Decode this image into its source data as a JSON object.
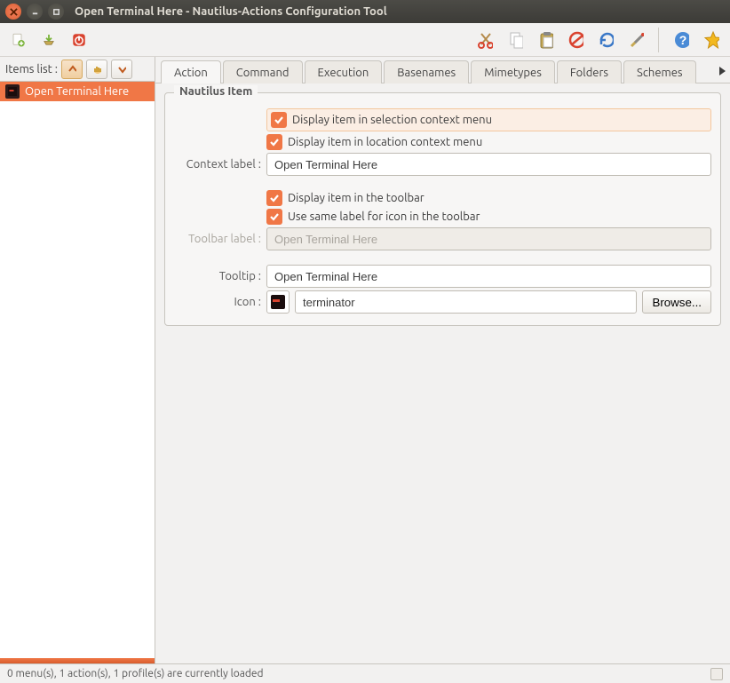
{
  "window": {
    "title": "Open Terminal Here - Nautilus-Actions Configuration Tool"
  },
  "listHeader": {
    "label": "Items list :"
  },
  "tree": {
    "items": [
      {
        "label": "Open Terminal Here"
      }
    ]
  },
  "tabs": {
    "items": [
      "Action",
      "Command",
      "Execution",
      "Basenames",
      "Mimetypes",
      "Folders",
      "Schemes"
    ],
    "active": 0
  },
  "group": {
    "title": "Nautilus Item"
  },
  "form": {
    "cbSelection": "Display item in selection context menu",
    "cbLocation": "Display item in location context menu",
    "contextLabel": "Context label :",
    "contextValue": "Open Terminal Here",
    "cbToolbar": "Display item in the toolbar",
    "cbSameLabel": "Use same label for icon in the toolbar",
    "toolbarLabel": "Toolbar label :",
    "toolbarValue": "Open Terminal Here",
    "tooltipLabel": "Tooltip :",
    "tooltipValue": "Open Terminal Here",
    "iconLabel": "Icon :",
    "iconValue": "terminator",
    "browse": "Browse..."
  },
  "status": {
    "text": "0 menu(s), 1 action(s), 1 profile(s) are currently loaded"
  }
}
